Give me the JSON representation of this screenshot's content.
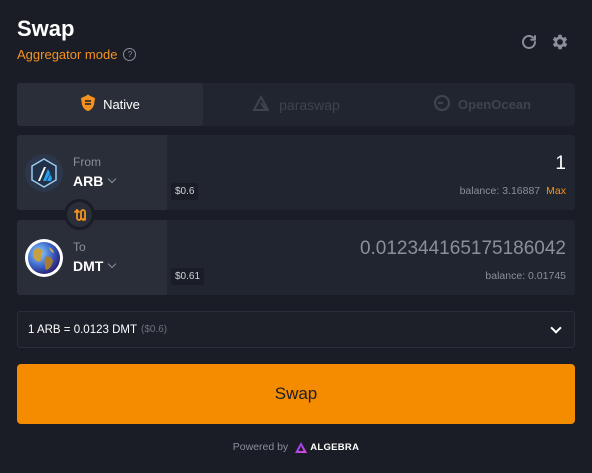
{
  "header": {
    "title": "Swap",
    "mode_label": "Aggregator mode",
    "help_icon": "help-circle-icon",
    "refresh_icon": "refresh-icon",
    "settings_icon": "gear-icon"
  },
  "tabs": [
    {
      "label": "Native",
      "icon": "native-shield-icon",
      "active": true
    },
    {
      "label": "paraswap",
      "icon": "paraswap-icon",
      "active": false
    },
    {
      "label": "OpenOcean",
      "icon": "openocean-icon",
      "active": false
    }
  ],
  "from": {
    "label": "From",
    "symbol": "ARB",
    "usd": "$0.6",
    "amount": "1",
    "balance": "balance: 3.16887",
    "max_label": "Max",
    "logo_icon": "arbitrum-logo-icon"
  },
  "to": {
    "label": "To",
    "symbol": "DMT",
    "usd": "$0.61",
    "amount": "0.012344165175186042",
    "balance": "balance: 0.01745",
    "logo_icon": "dmt-globe-logo-icon"
  },
  "switch": {
    "glyph": "⇅"
  },
  "rate": {
    "text": "1 ARB = 0.0123 DMT",
    "usd": "($0.6)"
  },
  "swap_button": {
    "label": "Swap"
  },
  "footer": {
    "powered_by": "Powered by",
    "brand": "ALGEBRA"
  },
  "colors": {
    "accent": "#f58c00",
    "background": "#1a1d26",
    "panel": "#21252f"
  }
}
